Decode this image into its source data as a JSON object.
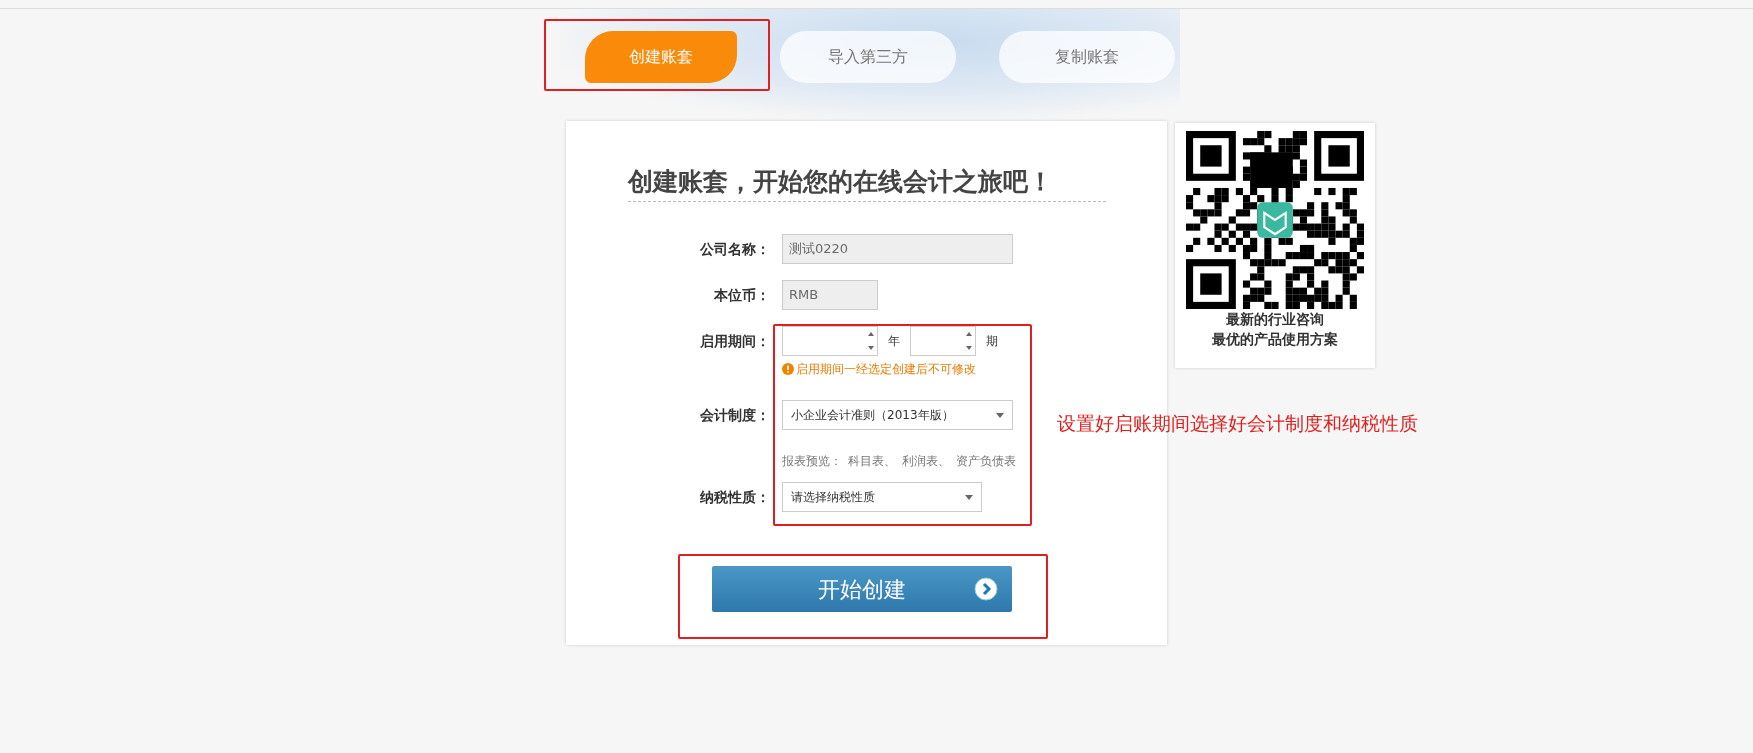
{
  "tabs": [
    {
      "label": "创建账套",
      "selected": true
    },
    {
      "label": "导入第三方",
      "selected": false
    },
    {
      "label": "复制账套",
      "selected": false
    }
  ],
  "form": {
    "title": "创建账套，开始您的在线会计之旅吧！",
    "fields": [
      {
        "kind": "text",
        "label": "公司名称：",
        "value": "测试0220"
      },
      {
        "kind": "text",
        "label": "本位币：",
        "value": "RMB"
      },
      {
        "kind": "period",
        "label": "启用期间：",
        "units": [
          "年",
          "期"
        ],
        "hint": "启用期间一经选定创建后不可修改"
      },
      {
        "kind": "select",
        "label": "会计制度：",
        "value": "小企业会计准则（2013年版）",
        "preview_label": "报表预览：",
        "preview_links": [
          "科目表、",
          "利润表、",
          "资产负债表"
        ]
      },
      {
        "kind": "select",
        "label": "纳税性质：",
        "value": "请选择纳税性质"
      }
    ],
    "submit": "开始创建"
  },
  "qr_card": {
    "lines": [
      "最新的行业咨询",
      "最优的产品使用方案"
    ]
  },
  "annotation": {
    "note": "设置好启账期间选择好会计制度和纳税性质"
  }
}
